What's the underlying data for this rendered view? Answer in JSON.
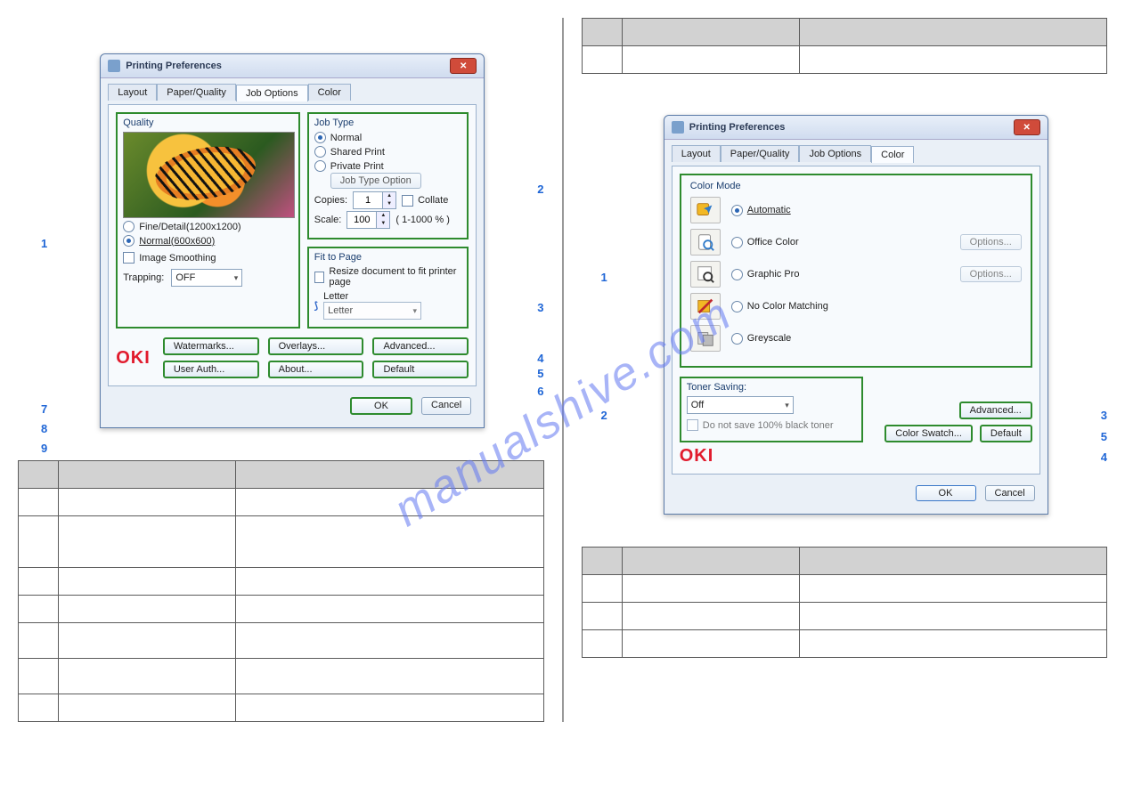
{
  "watermark_text": "manualshive.com",
  "left": {
    "window": {
      "title": "Printing Preferences",
      "tabs": [
        "Layout",
        "Paper/Quality",
        "Job Options",
        "Color"
      ],
      "active_tab": 2,
      "quality": {
        "title": "Quality",
        "opt_fine": "Fine/Detail(1200x1200)",
        "opt_normal": "Normal(600x600)",
        "image_smoothing": "Image Smoothing",
        "trapping_label": "Trapping:",
        "trapping_value": "OFF"
      },
      "jobtype": {
        "title": "Job Type",
        "normal": "Normal",
        "shared": "Shared Print",
        "private": "Private Print",
        "option_btn": "Job Type Option",
        "copies_label": "Copies:",
        "copies_value": "1",
        "collate": "Collate",
        "scale_label": "Scale:",
        "scale_value": "100",
        "scale_range": "( 1-1000 % )"
      },
      "fit": {
        "title": "Fit to Page",
        "resize": "Resize document to fit printer page",
        "letter_label": "Letter",
        "letter_value": "Letter"
      },
      "btns": {
        "watermarks": "Watermarks...",
        "overlays": "Overlays...",
        "advanced": "Advanced...",
        "userauth": "User Auth...",
        "about": "About...",
        "def": "Default",
        "ok": "OK",
        "cancel": "Cancel"
      },
      "logo": "OKI",
      "callouts": {
        "c1": "1",
        "c2": "2",
        "c3": "3",
        "c4": "4",
        "c5": "5",
        "c6": "6",
        "c7": "7",
        "c8": "8",
        "c9": "9"
      }
    }
  },
  "right": {
    "window": {
      "title": "Printing Preferences",
      "tabs": [
        "Layout",
        "Paper/Quality",
        "Job Options",
        "Color"
      ],
      "active_tab": 3,
      "colormode": {
        "title": "Color Mode",
        "automatic": "Automatic",
        "office": "Office Color",
        "graphic": "Graphic Pro",
        "nmatch": "No Color Matching",
        "grey": "Greyscale",
        "options": "Options..."
      },
      "toner": {
        "title": "Toner Saving:",
        "value": "Off",
        "black": "Do not save 100% black toner"
      },
      "btns": {
        "swatch": "Color Swatch...",
        "advanced": "Advanced...",
        "def": "Default",
        "ok": "OK",
        "cancel": "Cancel"
      },
      "logo": "OKI",
      "callouts": {
        "c1": "1",
        "c2": "2",
        "c3": "3",
        "c4": "4",
        "c5": "5"
      }
    }
  }
}
